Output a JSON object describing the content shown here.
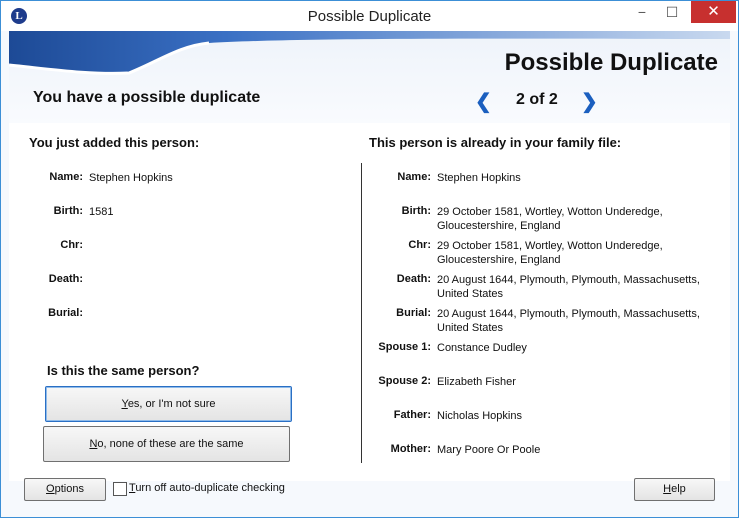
{
  "window": {
    "title": "Possible Duplicate",
    "app_icon": "L",
    "minimize": "−",
    "maximize": "☐",
    "close": "✕"
  },
  "header": {
    "dialog_title": "Possible Duplicate",
    "subtitle": "You have a possible duplicate",
    "nav_prev": "❮",
    "counter": "2 of 2",
    "nav_next": "❯"
  },
  "left": {
    "heading": "You just added this person:",
    "fields": [
      {
        "label": "Name:",
        "value": "Stephen Hopkins"
      },
      {
        "label": "Birth:",
        "value": "1581"
      },
      {
        "label": "Chr:",
        "value": ""
      },
      {
        "label": "Death:",
        "value": ""
      },
      {
        "label": "Burial:",
        "value": ""
      }
    ],
    "question": "Is this the same person?",
    "yes_button": {
      "u": "Y",
      "rest": "es, or I'm not sure"
    },
    "no_button": {
      "u": "N",
      "rest": "o, none of these are the same"
    }
  },
  "right": {
    "heading": "This person is already in your family file:",
    "fields": [
      {
        "label": "Name:",
        "line1": "Stephen Hopkins",
        "line2": ""
      },
      {
        "label": "Birth:",
        "line1": "29 October 1581, Wortley, Wotton Underedge,",
        "line2": "Gloucestershire, England"
      },
      {
        "label": "Chr:",
        "line1": "29 October 1581, Wortley, Wotton Underedge,",
        "line2": "Gloucestershire, England"
      },
      {
        "label": "Death:",
        "line1": "20 August 1644, Plymouth, Plymouth, Massachusetts,",
        "line2": "United States"
      },
      {
        "label": "Burial:",
        "line1": "20 August 1644, Plymouth, Plymouth, Massachusetts,",
        "line2": "United States"
      },
      {
        "label": "Spouse 1:",
        "line1": "Constance Dudley",
        "line2": ""
      },
      {
        "label": "Spouse 2:",
        "line1": "Elizabeth Fisher",
        "line2": ""
      },
      {
        "label": "Father:",
        "line1": "Nicholas Hopkins",
        "line2": ""
      },
      {
        "label": "Mother:",
        "line1": "Mary Poore Or Poole",
        "line2": ""
      }
    ]
  },
  "footer": {
    "options_button": {
      "u": "O",
      "rest": "ptions"
    },
    "auto_check_label": {
      "u": "T",
      "rest": "urn off auto-duplicate checking"
    },
    "help_button": {
      "u": "H",
      "rest": "elp"
    }
  },
  "colors": {
    "accent": "#1b5fbf",
    "banner_blue": "#2a5aa8",
    "close_red": "#c7302f"
  }
}
